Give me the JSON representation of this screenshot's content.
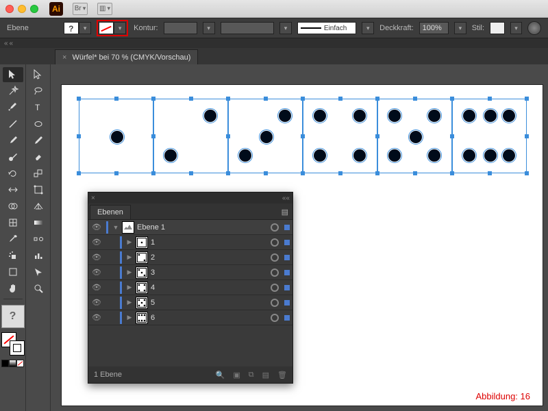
{
  "app": {
    "short_name": "Ai",
    "bridge_label": "Br"
  },
  "controlbar": {
    "layer_label": "Ebene",
    "stroke_label": "Kontur:",
    "stroke_style": "Einfach",
    "opacity_label": "Deckkraft:",
    "opacity_value": "100%",
    "style_label": "Stil:"
  },
  "document": {
    "tab_title": "Würfel* bei 70 % (CMYK/Vorschau)"
  },
  "dice": [
    {
      "face": 1,
      "pips": [
        [
          50,
          50
        ]
      ]
    },
    {
      "face": 2,
      "pips": [
        [
          75,
          22
        ],
        [
          22,
          75
        ]
      ]
    },
    {
      "face": 3,
      "pips": [
        [
          75,
          22
        ],
        [
          50,
          50
        ],
        [
          22,
          75
        ]
      ]
    },
    {
      "face": 4,
      "pips": [
        [
          22,
          22
        ],
        [
          75,
          22
        ],
        [
          22,
          75
        ],
        [
          75,
          75
        ]
      ]
    },
    {
      "face": 5,
      "pips": [
        [
          22,
          22
        ],
        [
          75,
          22
        ],
        [
          50,
          50
        ],
        [
          22,
          75
        ],
        [
          75,
          75
        ]
      ]
    },
    {
      "face": 6,
      "pips": [
        [
          22,
          22
        ],
        [
          50,
          22
        ],
        [
          75,
          22
        ],
        [
          22,
          75
        ],
        [
          50,
          75
        ],
        [
          75,
          75
        ]
      ]
    }
  ],
  "layers_panel": {
    "title": "Ebenen",
    "top_layer": "Ebene 1",
    "rows": [
      {
        "name": "1",
        "face": 1
      },
      {
        "name": "2",
        "face": 2
      },
      {
        "name": "3",
        "face": 3
      },
      {
        "name": "4",
        "face": 4
      },
      {
        "name": "5",
        "face": 5
      },
      {
        "name": "6",
        "face": 6
      }
    ],
    "footer": "1 Ebene"
  },
  "caption": "Abbildung: 16"
}
